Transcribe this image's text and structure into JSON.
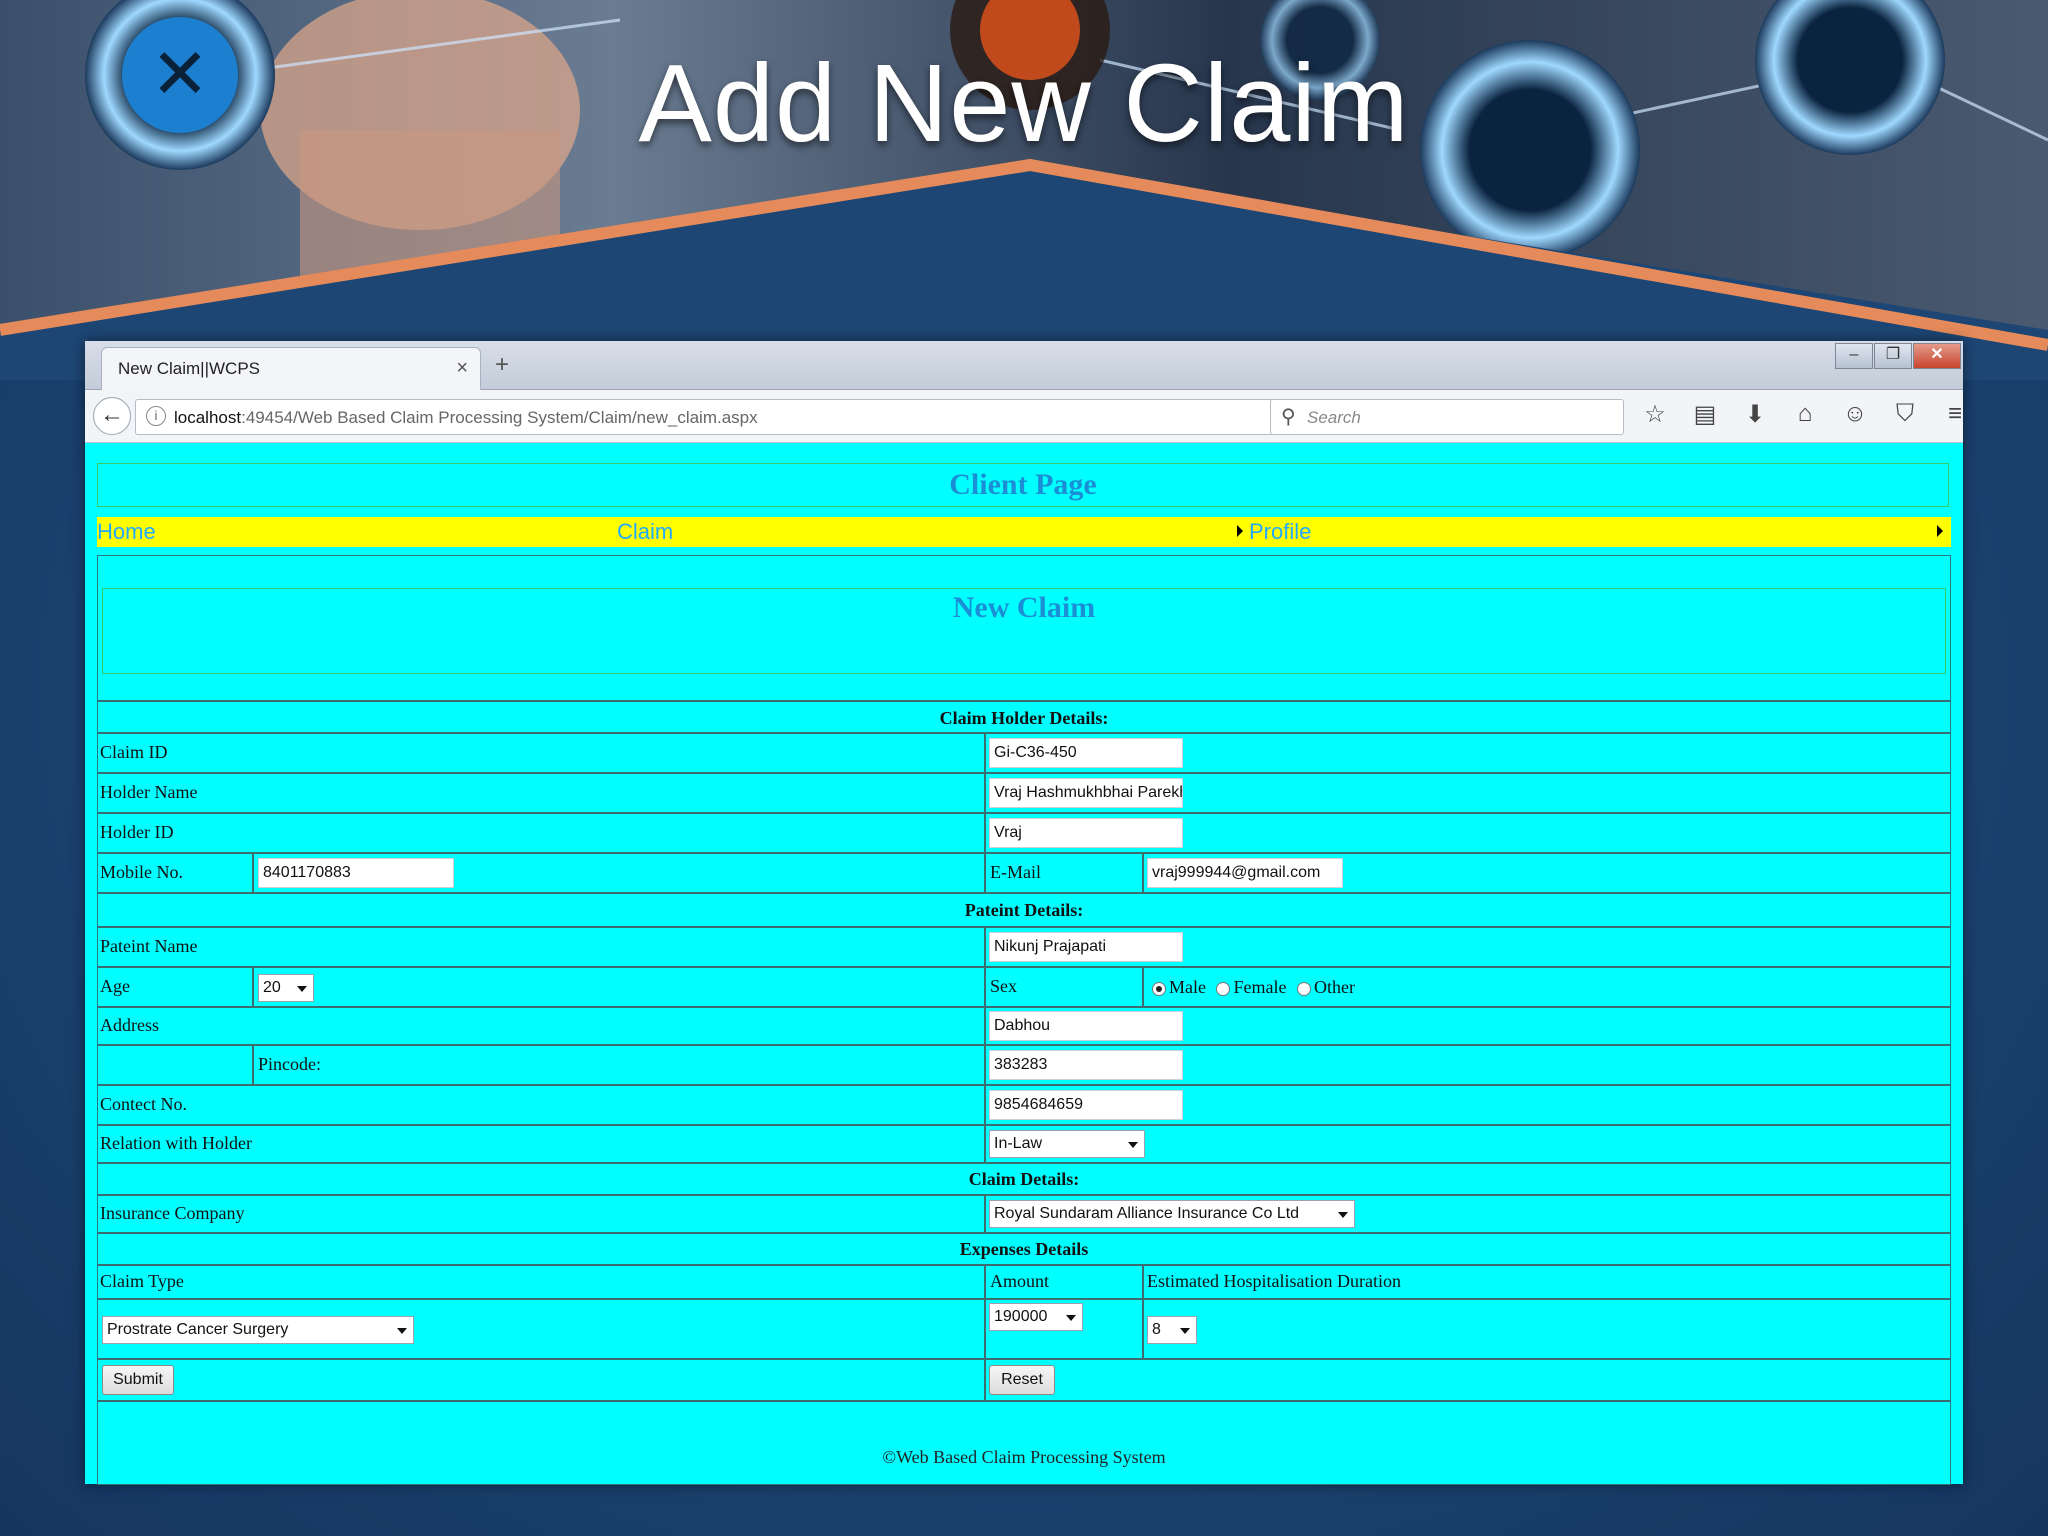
{
  "slide": {
    "title": "Add New Claim"
  },
  "browser": {
    "tab_title": "New Claim||WCPS",
    "tab_close": "×",
    "new_tab": "+",
    "url_host": "localhost",
    "url_path": ":49454/Web Based Claim Processing System/Claim/new_claim.aspx",
    "search_placeholder": "Search"
  },
  "page": {
    "client_title": "Client Page",
    "menu": {
      "home": "Home",
      "claim": "Claim",
      "profile": "Profile"
    },
    "new_claim_title": "New Claim",
    "sections": {
      "holder": "Claim Holder Details:",
      "patient": "Pateint Details:",
      "claim": "Claim Details:",
      "expenses": "Expenses Details"
    },
    "labels": {
      "claim_id": "Claim ID",
      "holder_name": "Holder Name",
      "holder_id": "Holder ID",
      "mobile": "Mobile No.",
      "email": "E-Mail",
      "patient_name": "Pateint Name",
      "age": "Age",
      "sex": "Sex",
      "address": "Address",
      "pincode": "Pincode:",
      "contact": "Contect No.",
      "relation": "Relation with Holder",
      "insurance_company": "Insurance Company",
      "claim_type": "Claim Type",
      "amount": "Amount",
      "duration": "Estimated Hospitalisation Duration"
    },
    "values": {
      "claim_id": "Gi-C36-450",
      "holder_name": "Vraj Hashmukhbhai Parekh",
      "holder_id": "Vraj",
      "mobile": "8401170883",
      "email": "vraj999944@gmail.com",
      "patient_name": "Nikunj Prajapati",
      "age": "20",
      "address": "Dabhou",
      "pincode": "383283",
      "contact": "9854684659",
      "relation": "In-Law",
      "insurance_company": "Royal Sundaram Alliance Insurance Co Ltd",
      "claim_type": "Prostrate Cancer Surgery",
      "amount": "190000",
      "duration": "8"
    },
    "sex_options": [
      "Male",
      "Female",
      "Other"
    ],
    "sex_selected": "Male",
    "buttons": {
      "submit": "Submit",
      "reset": "Reset"
    },
    "footer": "©Web Based Claim Processing System"
  }
}
